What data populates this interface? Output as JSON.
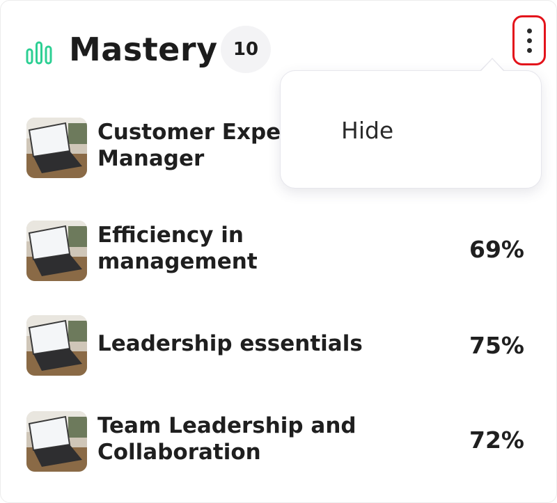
{
  "header": {
    "title": "Mastery",
    "count": "10",
    "icon": "bar-chart-icon",
    "accent_color": "#2ccf93",
    "more_icon": "kebab-menu-icon",
    "highlight_color": "#e3131b"
  },
  "courses": [
    {
      "title": "Customer Experience\nManager",
      "percent": "",
      "thumbnail": "laptop-on-desk-photo"
    },
    {
      "title": "Efficiency in\nmanagement",
      "percent": "69%",
      "thumbnail": "laptop-on-desk-photo"
    },
    {
      "title": "Leadership essentials",
      "percent": "75%",
      "thumbnail": "laptop-on-desk-photo"
    },
    {
      "title": "Team Leadership and\nCollaboration",
      "percent": "72%",
      "thumbnail": "laptop-on-desk-photo"
    }
  ],
  "menu": {
    "items": [
      {
        "label": "Hide"
      }
    ]
  }
}
